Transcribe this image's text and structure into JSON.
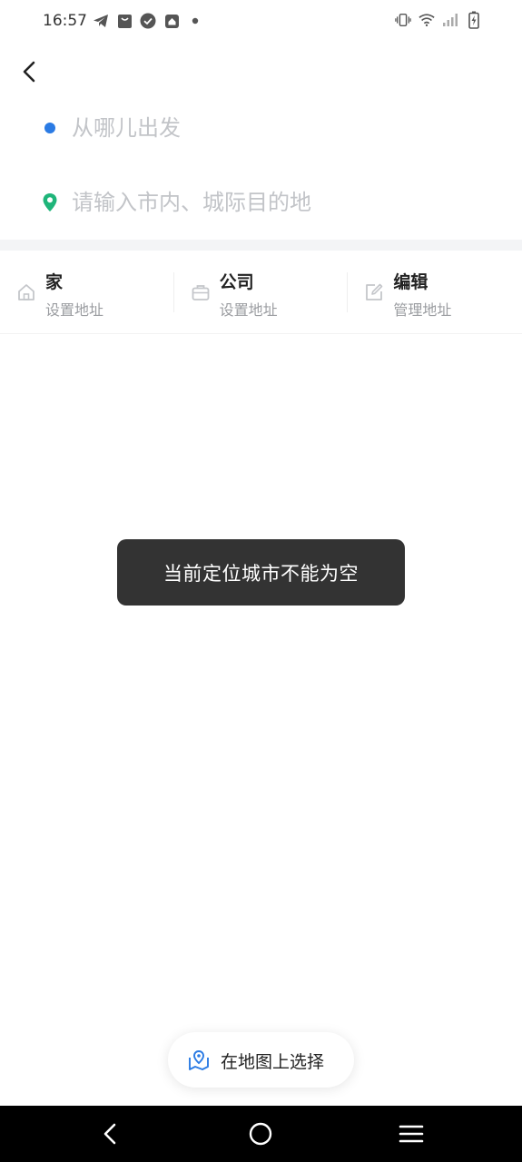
{
  "status_bar": {
    "time": "16:57",
    "left_icons": [
      "telegram-icon",
      "bag-icon",
      "check-circle-icon",
      "home-badge-icon",
      "dot-icon"
    ],
    "right_icons": [
      "vibrate-icon",
      "wifi-icon",
      "signal-icon",
      "battery-charging-icon"
    ]
  },
  "header": {
    "back_icon": "chevron-left-icon"
  },
  "route": {
    "from_placeholder": "从哪儿出发",
    "to_placeholder": "请输入市内、城际目的地",
    "from_dot_color": "#2b7be4",
    "to_pin_color": "#1fb57a"
  },
  "shortcuts": [
    {
      "title": "家",
      "subtitle": "设置地址",
      "icon": "home-icon"
    },
    {
      "title": "公司",
      "subtitle": "设置地址",
      "icon": "briefcase-icon"
    },
    {
      "title": "编辑",
      "subtitle": "管理地址",
      "icon": "edit-icon"
    }
  ],
  "toast": {
    "message": "当前定位城市不能为空"
  },
  "map_select": {
    "label": "在地图上选择",
    "icon": "map-pin-icon",
    "accent": "#2b7be4"
  },
  "nav_bar": {
    "icons": [
      "nav-back-icon",
      "nav-home-icon",
      "nav-menu-icon"
    ]
  }
}
